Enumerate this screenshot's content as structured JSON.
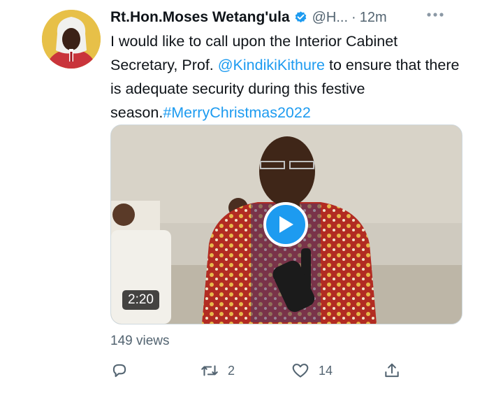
{
  "tweet": {
    "author_name": "Rt.Hon.Moses Wetang'ula",
    "handle": "@H...",
    "separator": "·",
    "time": "12m",
    "more_icon": "more-horizontal-icon",
    "verified_icon": "verified-badge-icon",
    "text_parts": {
      "p1": "I would like to call upon the Interior Cabinet Secretary, Prof. ",
      "mention": "@KindikiKithure",
      "p2": " to ensure that there is adequate security during this festive season.",
      "hashtag": "#MerryChristmas2022"
    }
  },
  "media": {
    "duration": "2:20",
    "play_icon": "play-icon"
  },
  "views": "149 views",
  "actions": {
    "reply": {
      "icon": "reply-icon",
      "count": ""
    },
    "retweet": {
      "icon": "retweet-icon",
      "count": "2"
    },
    "like": {
      "icon": "like-icon",
      "count": "14"
    },
    "share": {
      "icon": "share-icon",
      "count": ""
    }
  },
  "colors": {
    "accent": "#1d9bf0",
    "text": "#0f1419",
    "secondary": "#536471"
  }
}
